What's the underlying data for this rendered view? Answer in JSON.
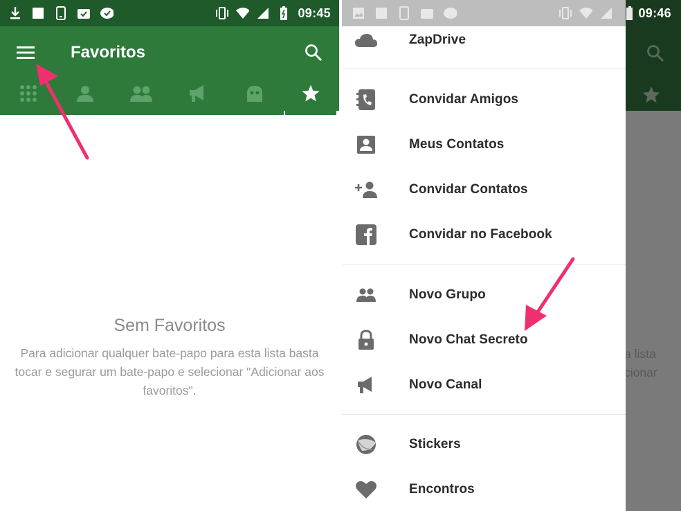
{
  "left_screen": {
    "status": {
      "time": "09:45"
    },
    "appbar": {
      "title": "Favoritos"
    },
    "tabs": [
      {
        "name": "tab-dialpad",
        "icon": "dialpad-icon"
      },
      {
        "name": "tab-contacts",
        "icon": "person-icon"
      },
      {
        "name": "tab-groups",
        "icon": "group-icon"
      },
      {
        "name": "tab-channels",
        "icon": "megaphone-icon"
      },
      {
        "name": "tab-bots",
        "icon": "bot-icon"
      },
      {
        "name": "tab-favorites",
        "icon": "star-icon",
        "active": true
      }
    ],
    "empty_state": {
      "title": "Sem Favoritos",
      "text": "Para adicionar qualquer bate-papo para esta lista basta tocar e segurar um bate-papo e selecionar \"Adicionar aos favoritos\"."
    }
  },
  "right_screen": {
    "status": {
      "time": "09:46"
    },
    "background_text": "a lista\ncionar",
    "drawer": {
      "items": [
        {
          "label": "ZapDrive",
          "icon": "cloud-icon"
        },
        {
          "label": "Convidar Amigos",
          "icon": "phonebook-icon"
        },
        {
          "label": "Meus Contatos",
          "icon": "contact-card-icon"
        },
        {
          "label": "Convidar Contatos",
          "icon": "add-person-icon"
        },
        {
          "label": "Convidar no Facebook",
          "icon": "facebook-icon"
        },
        {
          "label": "Novo Grupo",
          "icon": "group-icon"
        },
        {
          "label": "Novo Chat Secreto",
          "icon": "lock-icon"
        },
        {
          "label": "Novo Canal",
          "icon": "megaphone-icon"
        },
        {
          "label": "Stickers",
          "icon": "sticker-icon"
        },
        {
          "label": "Encontros",
          "icon": "heart-icon"
        }
      ]
    }
  },
  "colors": {
    "appbar": "#2d7a3a",
    "statusbar": "#1f5a2a",
    "annotation_arrow": "#f0306e",
    "drawer_icon": "#6b6b6b"
  }
}
